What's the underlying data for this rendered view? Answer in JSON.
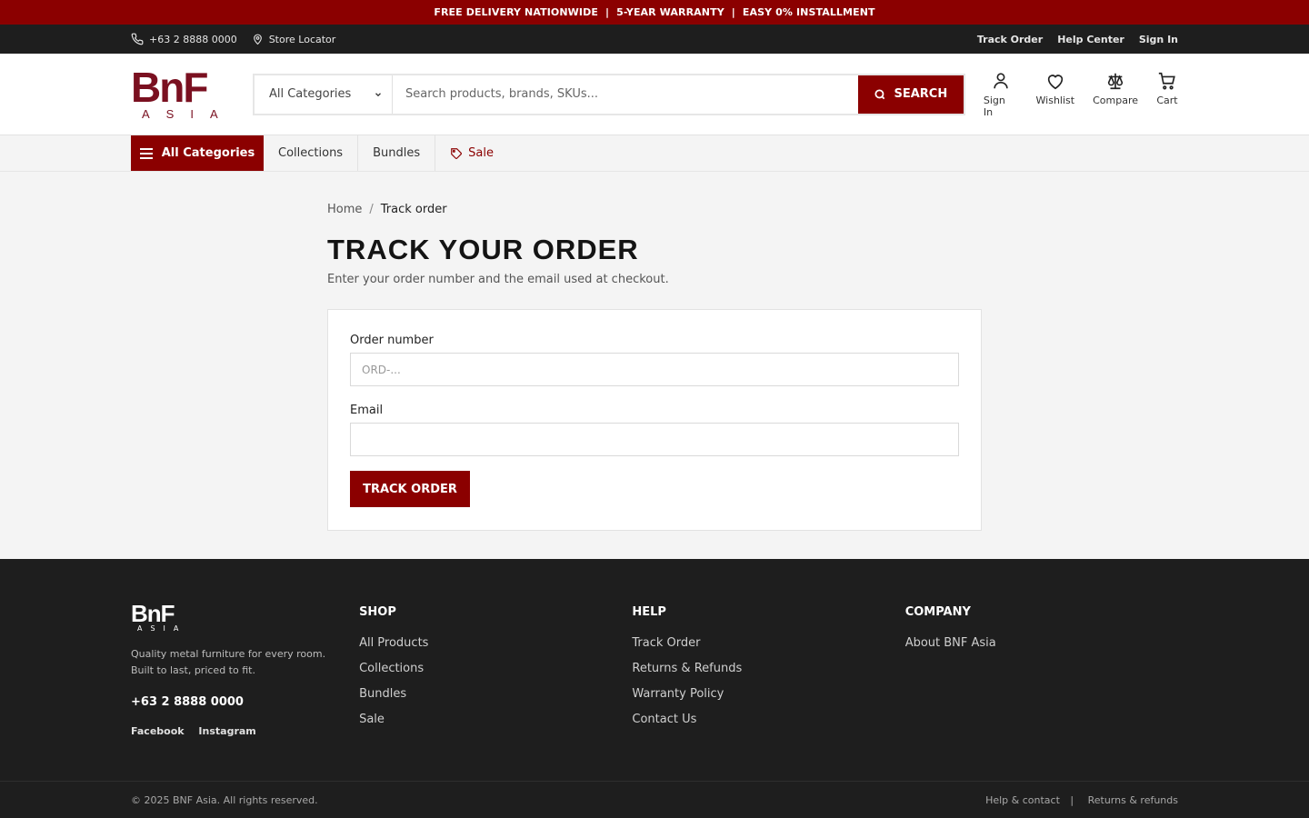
{
  "promo": {
    "items": [
      "FREE DELIVERY NATIONWIDE",
      "5-YEAR WARRANTY",
      "EASY 0% INSTALLMENT"
    ],
    "separator": "|"
  },
  "util": {
    "phone": "+63 2 8888 0000",
    "store_locator": "Store Locator",
    "links": [
      "Track Order",
      "Help Center",
      "Sign In"
    ]
  },
  "header": {
    "logo": {
      "mark": "BnF",
      "sub": "ASIA"
    },
    "search": {
      "category": "All Categories",
      "placeholder": "Search products, brands, SKUs...",
      "button": "SEARCH"
    },
    "actions": [
      "Sign In",
      "Wishlist",
      "Compare",
      "Cart"
    ]
  },
  "nav": {
    "all_categories": "All Categories",
    "links": [
      "Collections",
      "Bundles"
    ],
    "sale": "Sale"
  },
  "main": {
    "breadcrumb": {
      "home": "Home",
      "sep": "/",
      "current": "Track order"
    },
    "title": "TRACK YOUR ORDER",
    "subtitle": "Enter your order number and the email used at checkout.",
    "form": {
      "order_label": "Order number",
      "order_placeholder": "ORD-...",
      "email_label": "Email",
      "email_placeholder": "",
      "button": "TRACK ORDER"
    }
  },
  "footer": {
    "logo": {
      "mark": "BnF",
      "sub": "ASIA"
    },
    "description": "Quality metal furniture for every room. Built to last, priced to fit.",
    "phone": "+63 2 8888 0000",
    "social": [
      "Facebook",
      "Instagram"
    ],
    "columns": [
      {
        "heading": "SHOP",
        "links": [
          "All Products",
          "Collections",
          "Bundles",
          "Sale"
        ]
      },
      {
        "heading": "HELP",
        "links": [
          "Track Order",
          "Returns & Refunds",
          "Warranty Policy",
          "Contact Us"
        ]
      },
      {
        "heading": "COMPANY",
        "links": [
          "About BNF Asia"
        ]
      }
    ],
    "copyright": "© 2025 BNF Asia. All rights reserved.",
    "bottom_links": [
      "Help & contact",
      "Returns & refunds"
    ],
    "bottom_sep": "|"
  },
  "colors": {
    "brand": "#8b0000",
    "dark": "#1e1e1e",
    "logo": "#7a1020"
  }
}
